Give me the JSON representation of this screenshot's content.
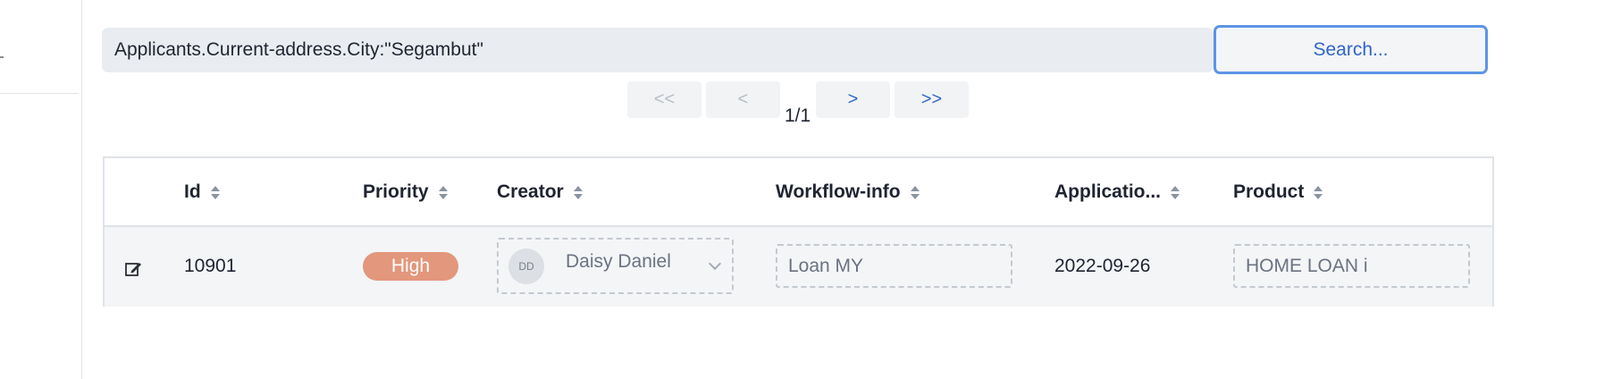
{
  "search": {
    "query": "Applicants.Current-address.City:\"Segambut\"",
    "button_label": "Search..."
  },
  "pagination": {
    "first": "<<",
    "prev": "<",
    "next": ">",
    "last": ">>",
    "indicator": "1/1"
  },
  "table": {
    "columns": [
      "Id",
      "Priority",
      "Creator",
      "Workflow-info",
      "Applicatio...",
      "Product"
    ],
    "rows": [
      {
        "id": "10901",
        "priority": "High",
        "creator_initials": "DD",
        "creator_name": "Daisy Daniel",
        "workflow_info": "Loan MY",
        "application_date": "2022-09-26",
        "product": "HOME LOAN i"
      }
    ]
  },
  "colors": {
    "accent": "#2f66c7",
    "priority_high": "#e3977c"
  }
}
